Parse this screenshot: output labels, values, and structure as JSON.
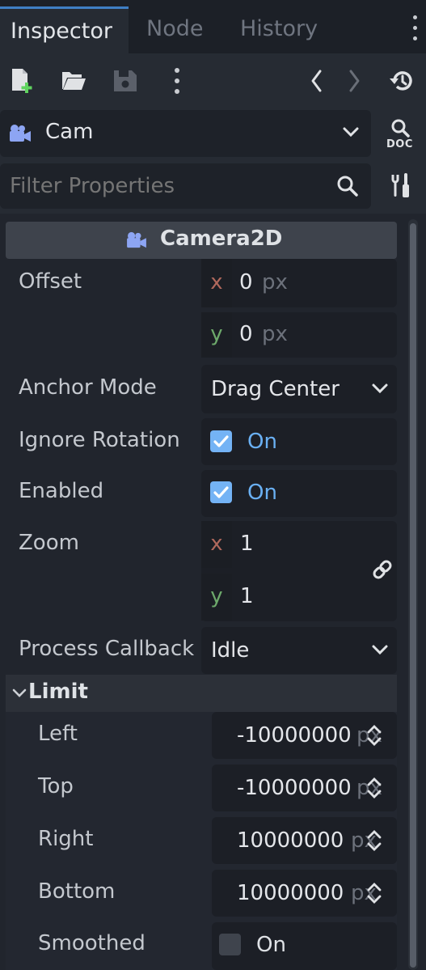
{
  "tabs": [
    {
      "label": "Inspector",
      "active": true
    },
    {
      "label": "Node",
      "active": false
    },
    {
      "label": "History",
      "active": false
    }
  ],
  "toolbar": {
    "icons": [
      "new-resource-icon",
      "open-folder-icon",
      "save-icon",
      "more-vertical-icon",
      "back-icon",
      "forward-icon",
      "history-icon"
    ]
  },
  "object": {
    "name": "Cam",
    "type_icon": "camera-icon",
    "doc_label": "DOC"
  },
  "filter": {
    "placeholder": "Filter Properties"
  },
  "section": {
    "title": "Camera2D"
  },
  "properties": {
    "offset": {
      "label": "Offset",
      "x": "0",
      "y": "0",
      "unit": "px"
    },
    "anchor_mode": {
      "label": "Anchor Mode",
      "value": "Drag Center"
    },
    "ignore_rotation": {
      "label": "Ignore Rotation",
      "checked": true,
      "text": "On"
    },
    "enabled": {
      "label": "Enabled",
      "checked": true,
      "text": "On"
    },
    "zoom": {
      "label": "Zoom",
      "x": "1",
      "y": "1"
    },
    "process_callback": {
      "label": "Process Callback",
      "value": "Idle"
    }
  },
  "axis_labels": {
    "x": "x",
    "y": "y"
  },
  "limit": {
    "title": "Limit",
    "left": {
      "label": "Left",
      "value": "-10000000",
      "unit": "px"
    },
    "top": {
      "label": "Top",
      "value": "-10000000",
      "unit": "px"
    },
    "right": {
      "label": "Right",
      "value": "10000000",
      "unit": "px"
    },
    "bottom": {
      "label": "Bottom",
      "value": "10000000",
      "unit": "px"
    },
    "smoothed": {
      "label": "Smoothed",
      "checked": false,
      "text": "On"
    }
  },
  "colors": {
    "accent": "#3f7fc4",
    "checkbox": "#74b3f5",
    "on_text": "#6ab0f3",
    "x_axis": "#b0685c",
    "y_axis": "#6da96b"
  }
}
